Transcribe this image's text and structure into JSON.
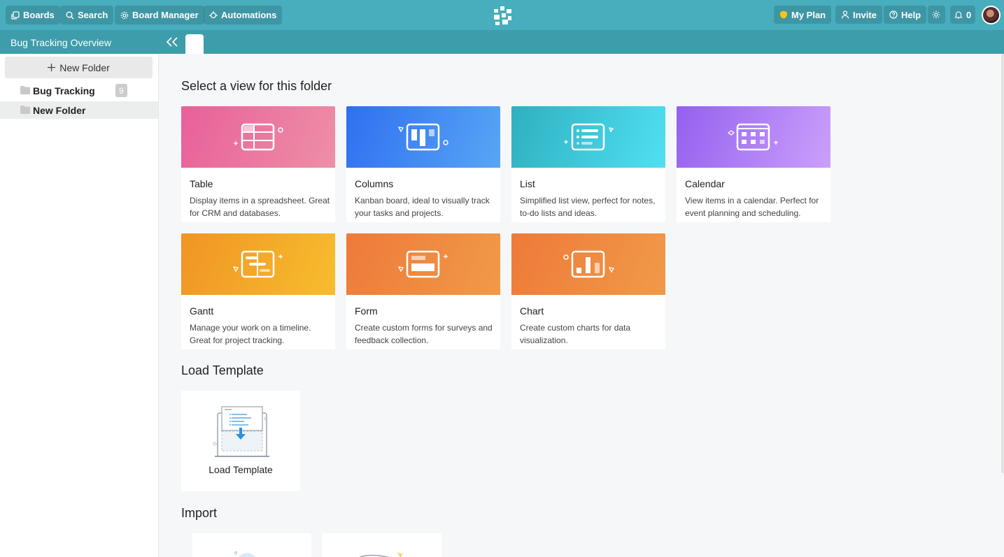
{
  "topbar": {
    "boards_label": "Boards",
    "search_label": "Search",
    "board_manager_label": "Board Manager",
    "automations_label": "Automations",
    "my_plan_label": "My Plan",
    "invite_label": "Invite",
    "help_label": "Help",
    "notifications_count": "0"
  },
  "subbar": {
    "board_title": "Bug Tracking Overview"
  },
  "sidebar": {
    "new_folder_label": "New Folder",
    "folders": [
      {
        "name": "Bug Tracking",
        "count": "9"
      },
      {
        "name": "New Folder"
      }
    ]
  },
  "main": {
    "select_view_title": "Select a view for this folder",
    "views": [
      {
        "name": "Table",
        "description": "Display items in a spreadsheet. Great for CRM and databases."
      },
      {
        "name": "Columns",
        "description": "Kanban board, ideal to visually track your tasks and projects."
      },
      {
        "name": "List",
        "description": "Simplified list view, perfect for notes, to-do lists and ideas."
      },
      {
        "name": "Calendar",
        "description": "View items in a calendar. Perfect for event planning and scheduling."
      },
      {
        "name": "Gantt",
        "description": "Manage your work on a timeline. Great for project tracking."
      },
      {
        "name": "Form",
        "description": "Create custom forms for surveys and feedback collection."
      },
      {
        "name": "Chart",
        "description": "Create custom charts for data visualization."
      }
    ],
    "load_template_title": "Load Template",
    "load_template_card_label": "Load Template",
    "import_title": "Import"
  },
  "colors": {
    "topbar": "#48adbd",
    "subbar": "#3e9dab",
    "table_gradient": [
      "#e8609a",
      "#ee8fa6"
    ],
    "columns_gradient": [
      "#2f6ff0",
      "#58a6f5"
    ],
    "list_gradient": [
      "#2eb0c0",
      "#50e0f2"
    ],
    "calendar_gradient": [
      "#9460ef",
      "#caa0fb"
    ],
    "gantt_gradient": [
      "#f09524",
      "#f7bd2e"
    ],
    "form_gradient": [
      "#ee7a3a",
      "#f09a48"
    ],
    "chart_gradient": [
      "#ee7a3a",
      "#f09a48"
    ],
    "my_plan_shield": "#f5c518"
  },
  "icons": {
    "boards": "boards-icon",
    "search": "search-icon",
    "board_manager": "gear-icon",
    "automations": "automation-icon",
    "my_plan": "shield-icon",
    "invite": "user-icon",
    "help": "help-circle-icon",
    "theme": "sun-icon",
    "notifications": "bell-icon",
    "collapse": "double-chevron-left-icon",
    "folder": "folder-icon"
  }
}
